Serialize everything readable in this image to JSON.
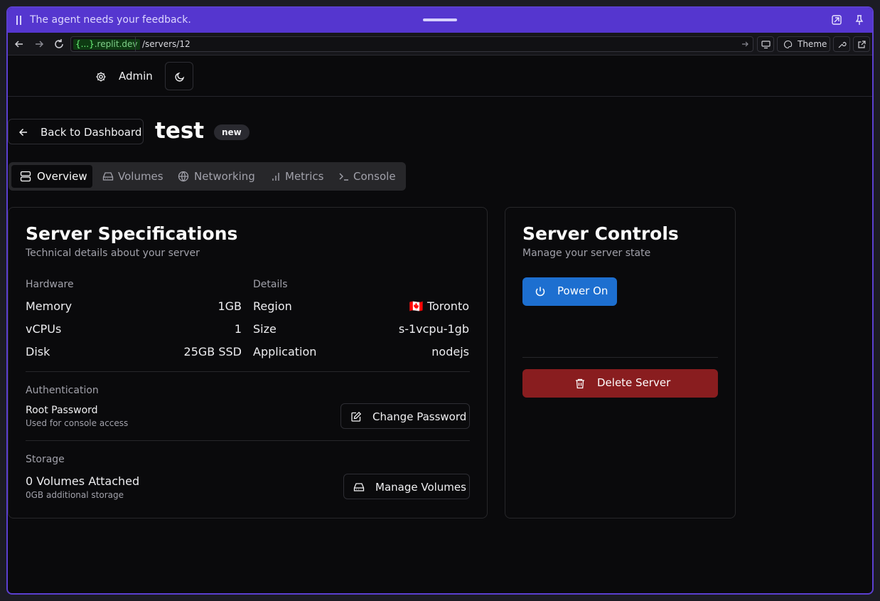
{
  "agent_bar": {
    "message": "The agent needs your feedback."
  },
  "browser": {
    "domain_prefix": "{...}",
    "domain_suffix": ".replit.dev",
    "path": "/servers/12",
    "theme_label": "Theme"
  },
  "header": {
    "admin_label": "Admin"
  },
  "page": {
    "back_label": "Back to Dashboard",
    "title": "test",
    "badge": "new"
  },
  "tabs": [
    {
      "label": "Overview",
      "icon": "server-icon",
      "active": true
    },
    {
      "label": "Volumes",
      "icon": "hard-drive-icon",
      "active": false
    },
    {
      "label": "Networking",
      "icon": "globe-icon",
      "active": false
    },
    {
      "label": "Metrics",
      "icon": "bar-chart-icon",
      "active": false
    },
    {
      "label": "Console",
      "icon": "terminal-icon",
      "active": false
    }
  ],
  "specs": {
    "title": "Server Specifications",
    "subtitle": "Technical details about your server",
    "hardware_label": "Hardware",
    "hardware": [
      {
        "key": "Memory",
        "value": "1GB"
      },
      {
        "key": "vCPUs",
        "value": "1"
      },
      {
        "key": "Disk",
        "value": "25GB SSD"
      }
    ],
    "details_label": "Details",
    "details": [
      {
        "key": "Region",
        "value": "Toronto",
        "flag": "🇨🇦"
      },
      {
        "key": "Size",
        "value": "s-1vcpu-1gb"
      },
      {
        "key": "Application",
        "value": "nodejs"
      }
    ],
    "auth_label": "Authentication",
    "root_password_label": "Root Password",
    "root_password_desc": "Used for console access",
    "change_password_label": "Change Password",
    "storage_label": "Storage",
    "volumes_attached": "0 Volumes Attached",
    "additional_storage": "0GB additional storage",
    "manage_volumes_label": "Manage Volumes"
  },
  "controls": {
    "title": "Server Controls",
    "subtitle": "Manage your server state",
    "power_on_label": "Power On",
    "delete_label": "Delete Server"
  },
  "colors": {
    "accent_purple": "#5536cf",
    "power_blue": "#1d6fd0",
    "delete_red": "#891d1f"
  }
}
